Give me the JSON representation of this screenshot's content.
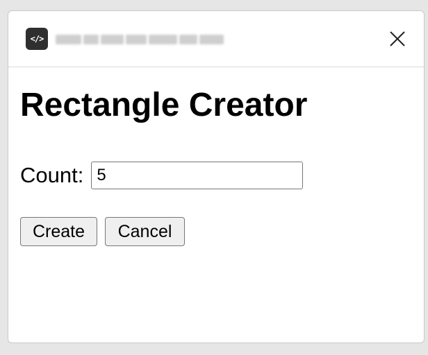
{
  "titlebar": {
    "app_icon_glyph": "</>",
    "app_icon_name": "code-icon",
    "close_icon_name": "close-icon"
  },
  "main": {
    "heading": "Rectangle Creator",
    "count_label": "Count:",
    "count_value": "5",
    "create_label": "Create",
    "cancel_label": "Cancel"
  },
  "colors": {
    "background": "#ffffff",
    "button_bg": "#efefef",
    "icon_bg": "#2f2f2f"
  }
}
